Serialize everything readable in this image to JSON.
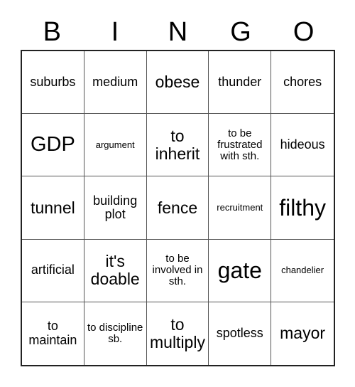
{
  "card": {
    "header_letters": [
      "B",
      "I",
      "N",
      "G",
      "O"
    ],
    "columns": 5,
    "rows": 5,
    "colors": {
      "background": "#ffffff",
      "text": "#000000",
      "outer_border": "#222222",
      "inner_grid_line": "#555555"
    },
    "cells": [
      {
        "text": "suburbs",
        "size": "size-sm"
      },
      {
        "text": "medium",
        "size": "size-sm"
      },
      {
        "text": "obese",
        "size": "size-md"
      },
      {
        "text": "thunder",
        "size": "size-sm"
      },
      {
        "text": "chores",
        "size": "size-sm"
      },
      {
        "text": "GDP",
        "size": "size-lg"
      },
      {
        "text": "argument",
        "size": "size-xxs"
      },
      {
        "text": "to inherit",
        "size": "size-md"
      },
      {
        "text": "to be frustrated with sth.",
        "size": "size-xs"
      },
      {
        "text": "hideous",
        "size": "size-sm"
      },
      {
        "text": "tunnel",
        "size": "size-md"
      },
      {
        "text": "building plot",
        "size": "size-sm"
      },
      {
        "text": "fence",
        "size": "size-md"
      },
      {
        "text": "recruitment",
        "size": "size-xxs"
      },
      {
        "text": "filthy",
        "size": "size-xl"
      },
      {
        "text": "artificial",
        "size": "size-sm"
      },
      {
        "text": "it's doable",
        "size": "size-md"
      },
      {
        "text": "to be involved in sth.",
        "size": "size-xs"
      },
      {
        "text": "gate",
        "size": "size-xl"
      },
      {
        "text": "chandelier",
        "size": "size-xxs"
      },
      {
        "text": "to maintain",
        "size": "size-sm"
      },
      {
        "text": "to discipline sb.",
        "size": "size-xs"
      },
      {
        "text": "to multiply",
        "size": "size-md"
      },
      {
        "text": "spotless",
        "size": "size-sm"
      },
      {
        "text": "mayor",
        "size": "size-md"
      }
    ]
  }
}
